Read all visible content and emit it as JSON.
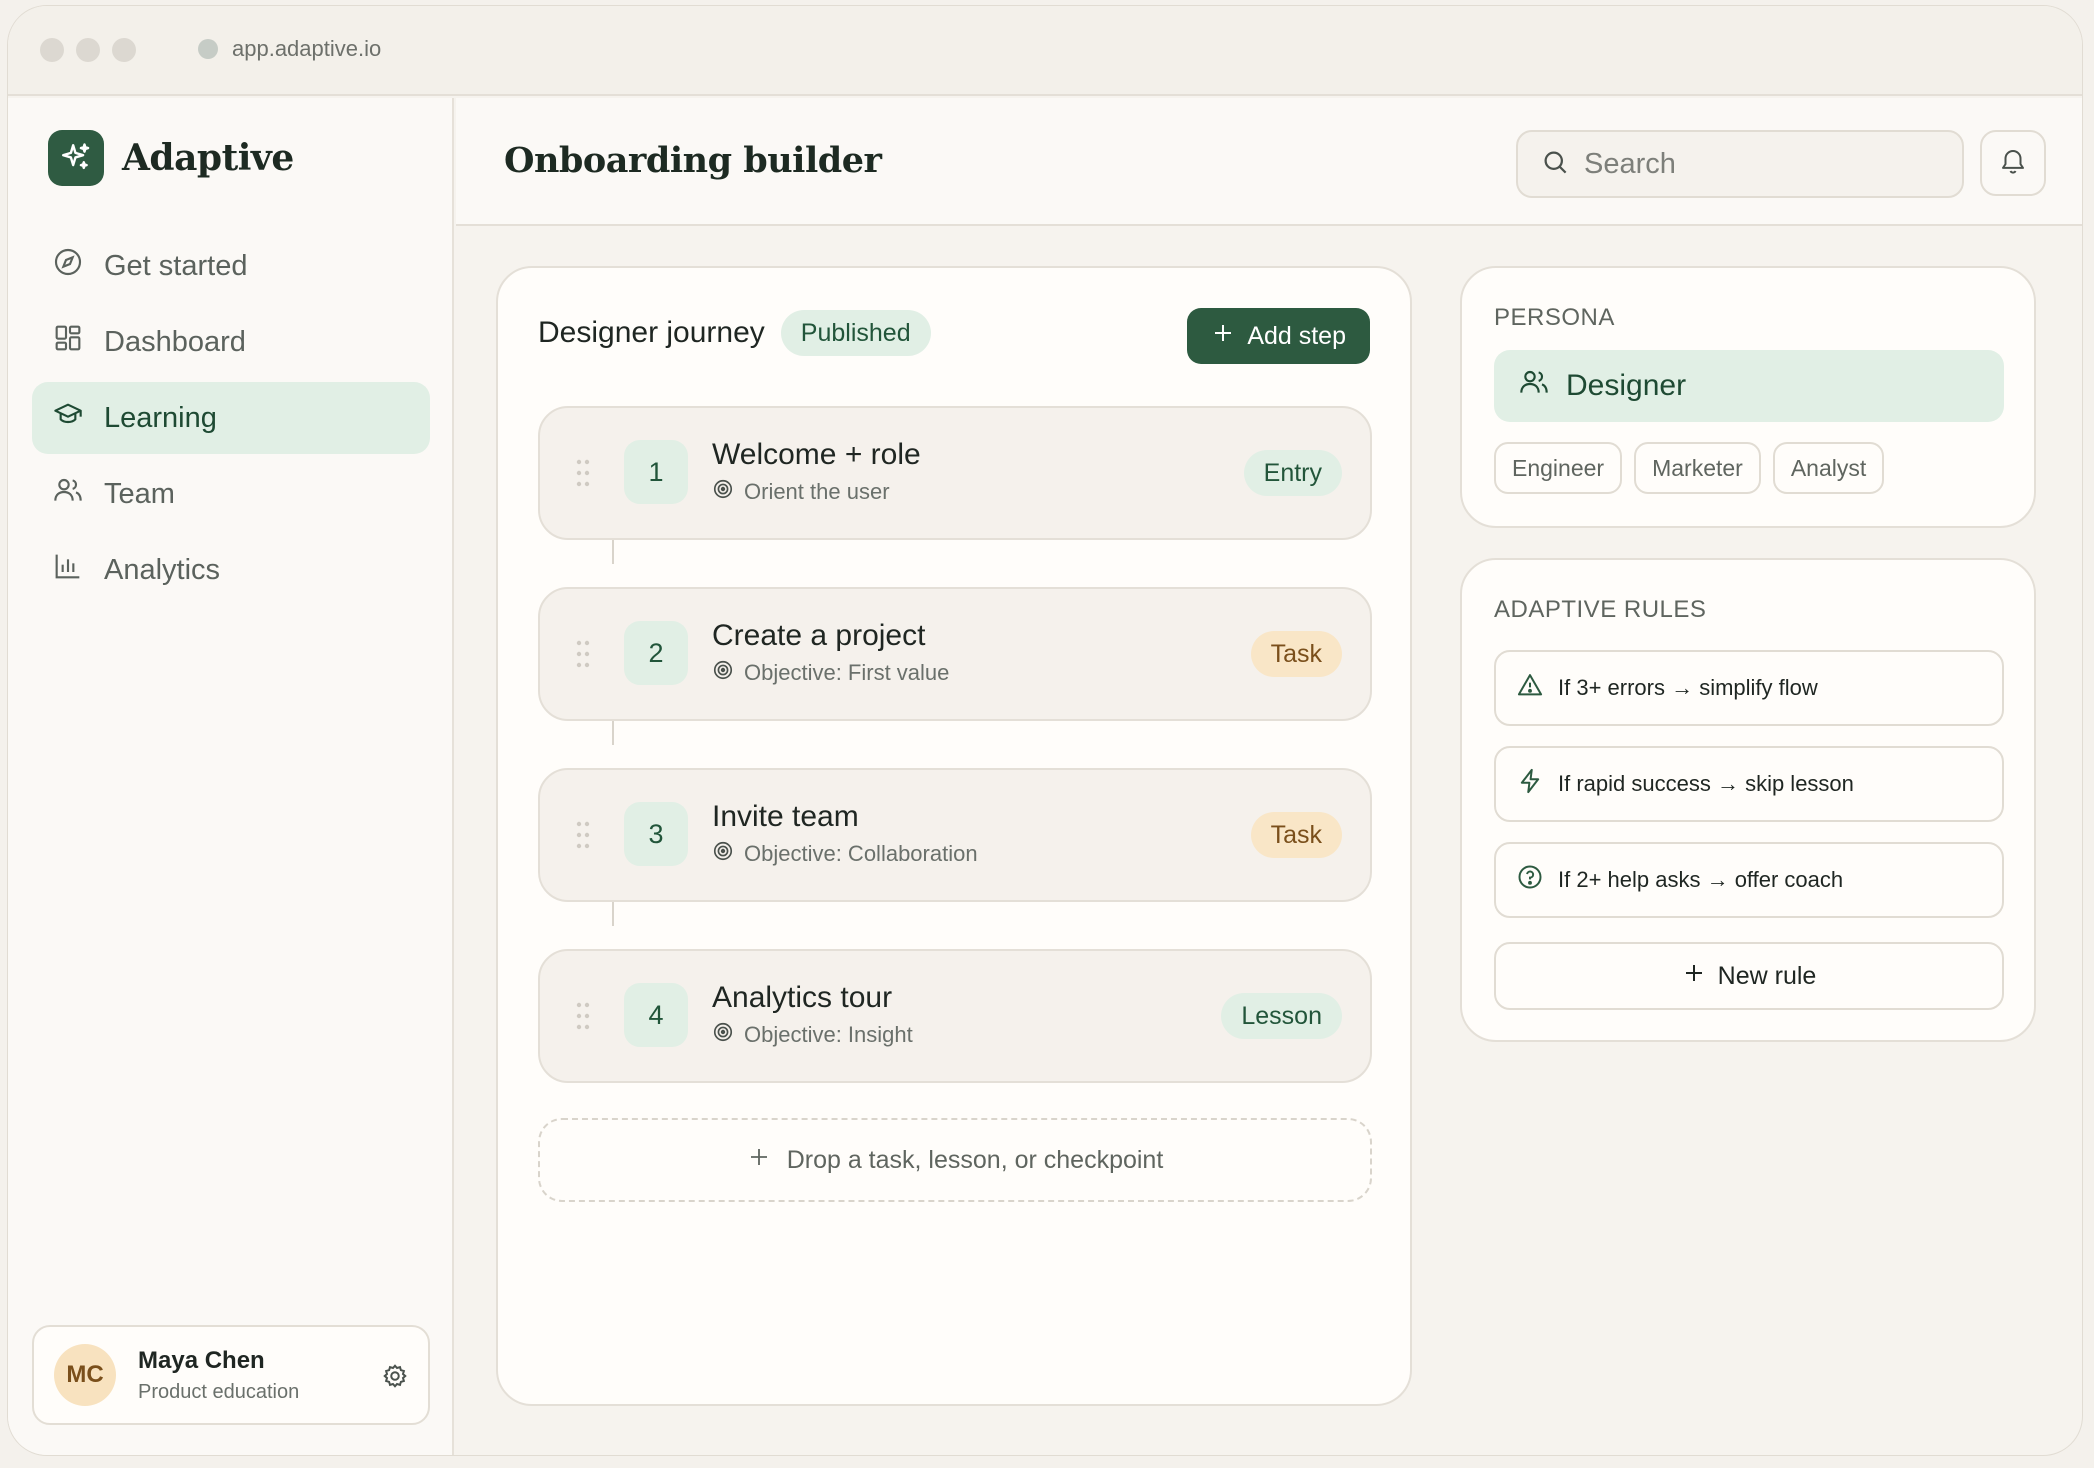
{
  "browser": {
    "url": "app.adaptive.io"
  },
  "brand": {
    "name": "Adaptive"
  },
  "nav": [
    {
      "label": "Get started",
      "icon": "compass-icon"
    },
    {
      "label": "Dashboard",
      "icon": "grid-icon"
    },
    {
      "label": "Learning",
      "icon": "graduation-cap-icon",
      "active": true
    },
    {
      "label": "Team",
      "icon": "users-icon"
    },
    {
      "label": "Analytics",
      "icon": "bar-chart-icon"
    }
  ],
  "user": {
    "initials": "MC",
    "name": "Maya Chen",
    "role": "Product education"
  },
  "header": {
    "title": "Onboarding builder",
    "search_placeholder": "Search"
  },
  "journey": {
    "title": "Designer journey",
    "status": "Published",
    "add_step_label": "Add step",
    "steps": [
      {
        "number": "1",
        "title": "Welcome + role",
        "subtitle": "Orient the user",
        "badge": "Entry",
        "badge_tone": "green"
      },
      {
        "number": "2",
        "title": "Create a project",
        "subtitle": "Objective: First value",
        "badge": "Task",
        "badge_tone": "amber"
      },
      {
        "number": "3",
        "title": "Invite team",
        "subtitle": "Objective: Collaboration",
        "badge": "Task",
        "badge_tone": "amber"
      },
      {
        "number": "4",
        "title": "Analytics tour",
        "subtitle": "Objective: Insight",
        "badge": "Lesson",
        "badge_tone": "green"
      }
    ],
    "drop_zone_label": "Drop a task, lesson, or checkpoint"
  },
  "persona": {
    "section_label": "PERSONA",
    "selected": "Designer",
    "options": [
      "Engineer",
      "Marketer",
      "Analyst"
    ]
  },
  "rules": {
    "section_label": "ADAPTIVE RULES",
    "items": [
      {
        "text": "If 3+ errors → simplify flow",
        "icon": "warning-icon"
      },
      {
        "text": "If rapid success → skip lesson",
        "icon": "lightning-icon"
      },
      {
        "text": "If 2+ help asks → offer coach",
        "icon": "help-circle-icon"
      }
    ],
    "new_rule_label": "New rule"
  },
  "colors": {
    "brand": "#2f5b42",
    "accent_bg": "#e1efe5",
    "task_badge_bg": "#f9e6c7",
    "page_bg": "#f4f1ec"
  }
}
